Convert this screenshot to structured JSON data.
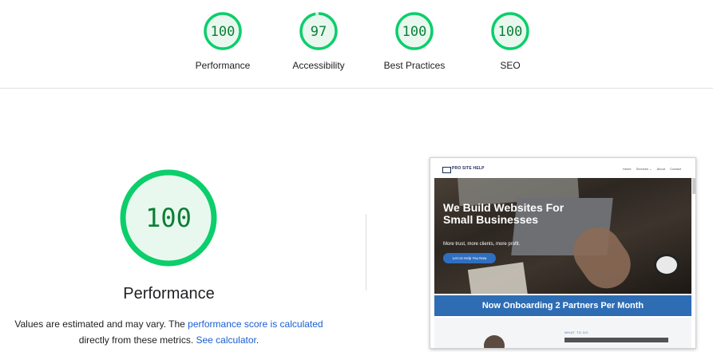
{
  "colors": {
    "pass": "#0cce6b",
    "pass_fill": "#e9f8ef",
    "pass_text": "#0b7f35",
    "link": "#1a5fd0"
  },
  "categories": [
    {
      "score": "100",
      "score_value": 100,
      "label": "Performance"
    },
    {
      "score": "97",
      "score_value": 97,
      "label": "Accessibility"
    },
    {
      "score": "100",
      "score_value": 100,
      "label": "Best Practices"
    },
    {
      "score": "100",
      "score_value": 100,
      "label": "SEO"
    }
  ],
  "main": {
    "score": "100",
    "score_value": 100,
    "title": "Performance",
    "desc_prefix": "Values are estimated and may vary. The ",
    "desc_link": "performance score is calculated",
    "desc_mid": "directly from these metrics. ",
    "desc_link2": "See calculator",
    "desc_suffix": "."
  },
  "thumbnail": {
    "logo_text": "PRO SITE HELP",
    "nav_items": [
      "Home",
      "Services ⌄",
      "About",
      "Contact"
    ],
    "hero_heading": "We Build Websites For Small Businesses",
    "hero_sub": "More trust, more clients, more profit.",
    "hero_button": "Let Us Help You Now",
    "banner": "Now Onboarding 2 Partners Per Month",
    "eyebrow": "WHAT TO DO"
  }
}
